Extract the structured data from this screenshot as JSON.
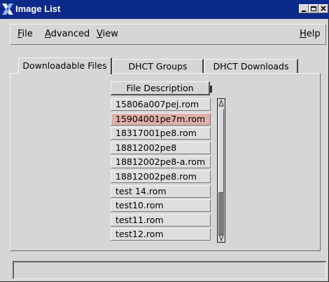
{
  "window": {
    "title": "Image List"
  },
  "menubar": {
    "file": {
      "mnemonic": "F",
      "rest": "ile"
    },
    "advanced": {
      "mnemonic": "A",
      "rest": "dvanced"
    },
    "view": {
      "mnemonic": "V",
      "rest": "iew"
    },
    "help": {
      "mnemonic": "H",
      "rest": "elp"
    }
  },
  "tabs": [
    {
      "label": "Downloadable Files",
      "active": true
    },
    {
      "label": "DHCT Groups",
      "active": false
    },
    {
      "label": "DHCT Downloads",
      "active": false
    }
  ],
  "list": {
    "header": "File Description",
    "selected_index": 1,
    "items": [
      "15806a007pej.rom",
      "15904001pe7m.rom",
      "18317001pe8.rom",
      "18812002pe8",
      "18812002pe8-a.rom",
      "18812002pe8.rom",
      "test 14.rom",
      "test10.rom",
      "test11.rom",
      "test12.rom"
    ],
    "selected_color": "#e0b0aa"
  },
  "statusbar": {
    "text": ""
  },
  "colors": {
    "titlebar": "#0b2a8a",
    "window_bg": "#d6d6d6"
  },
  "icons": {
    "app": "x-logo-icon",
    "minimize": "minimize-icon",
    "maximize": "maximize-icon",
    "close": "close-icon",
    "scroll_up": "scroll-up-arrow-icon",
    "scroll_down": "scroll-down-arrow-icon"
  }
}
